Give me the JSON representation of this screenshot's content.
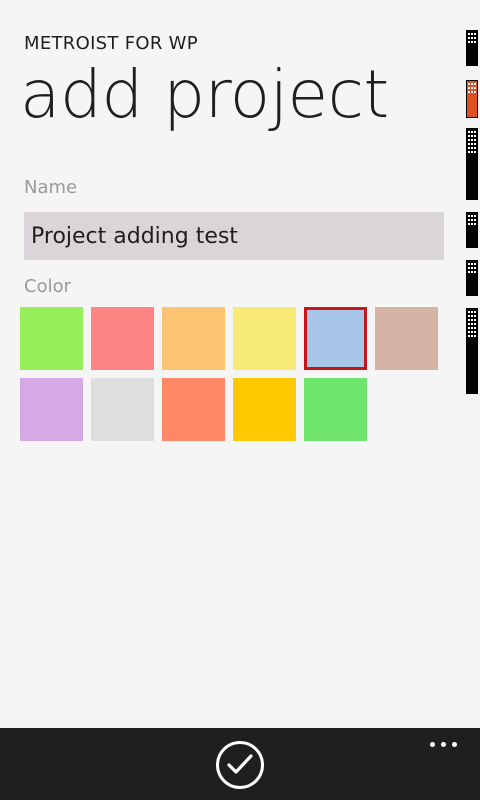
{
  "header": {
    "app_title": "METROIST FOR WP",
    "page_title": "add project"
  },
  "form": {
    "name_label": "Name",
    "name_value": "Project adding test",
    "color_label": "Color",
    "colors": [
      "#96ef5a",
      "#ff8585",
      "#ffc471",
      "#f7eb75",
      "#a8c6e7",
      "#d6b4a5",
      "#d5a9e5",
      "#dedede",
      "#ff8967",
      "#ffc800",
      "#70e56b"
    ],
    "selected_color_index": 4
  },
  "status_bar": {
    "accent_color": "#e05020"
  },
  "app_bar": {
    "accept_icon": "check-icon",
    "more_icon": "ellipsis-icon"
  }
}
